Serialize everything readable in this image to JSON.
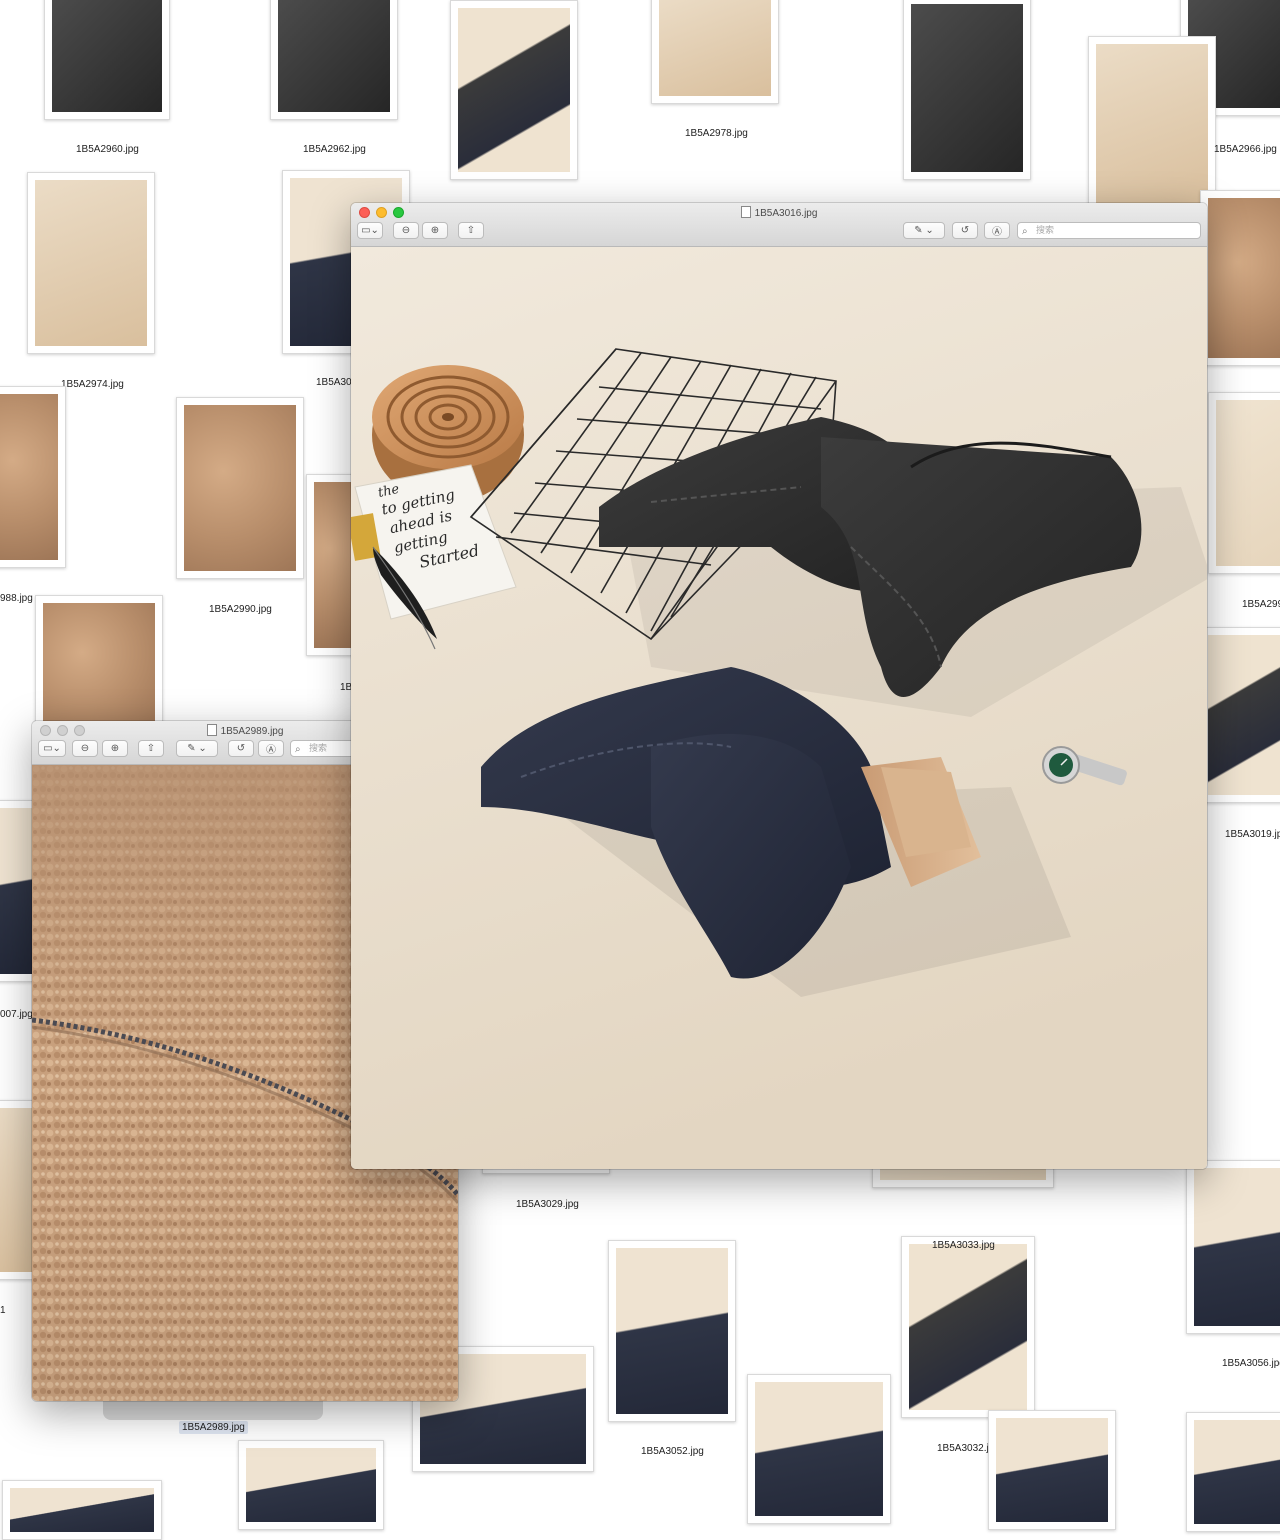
{
  "desktop": {
    "captions": {
      "c2960": "1B5A2960.jpg",
      "c2962": "1B5A2962.jpg",
      "c2978": "1B5A2978.jpg",
      "c2966": "1B5A2966.jpg",
      "c2974": "1B5A2974.jpg",
      "c300x": "1B5A300",
      "c2988": "988.jpg",
      "c2990": "1B5A2990.jpg",
      "c299x": "1B5A299",
      "c1b": "1B",
      "c3019": "1B5A3019.jpg",
      "c007": "007.jpg",
      "c3029": "1B5A3029.jpg",
      "c3033": "1B5A3033.jpg",
      "c3056": "1B5A3056.jpg",
      "c1": "1",
      "c2989": "1B5A2989.jpg",
      "c3052": "1B5A3052.jpg",
      "c3032": "1B5A3032.j"
    }
  },
  "main_window": {
    "title": "1B5A3016.jpg",
    "search_placeholder": "搜索"
  },
  "second_window": {
    "title": "1B5A2989.jpg",
    "search_placeholder": "搜索"
  },
  "photo_text": {
    "notebook_line1": "the",
    "notebook_line2": "to getting",
    "notebook_line3": "ahead is",
    "notebook_line4": "getting",
    "notebook_line5": "Started"
  },
  "colors": {
    "close": "#fc5f57",
    "minimize": "#fdbc2e",
    "zoom": "#29c840",
    "backdrop": "#ece3d4",
    "fleece": "#c49c78",
    "charcoal_pants": "#2e2e2e",
    "navy_pants": "#2a2f40"
  }
}
